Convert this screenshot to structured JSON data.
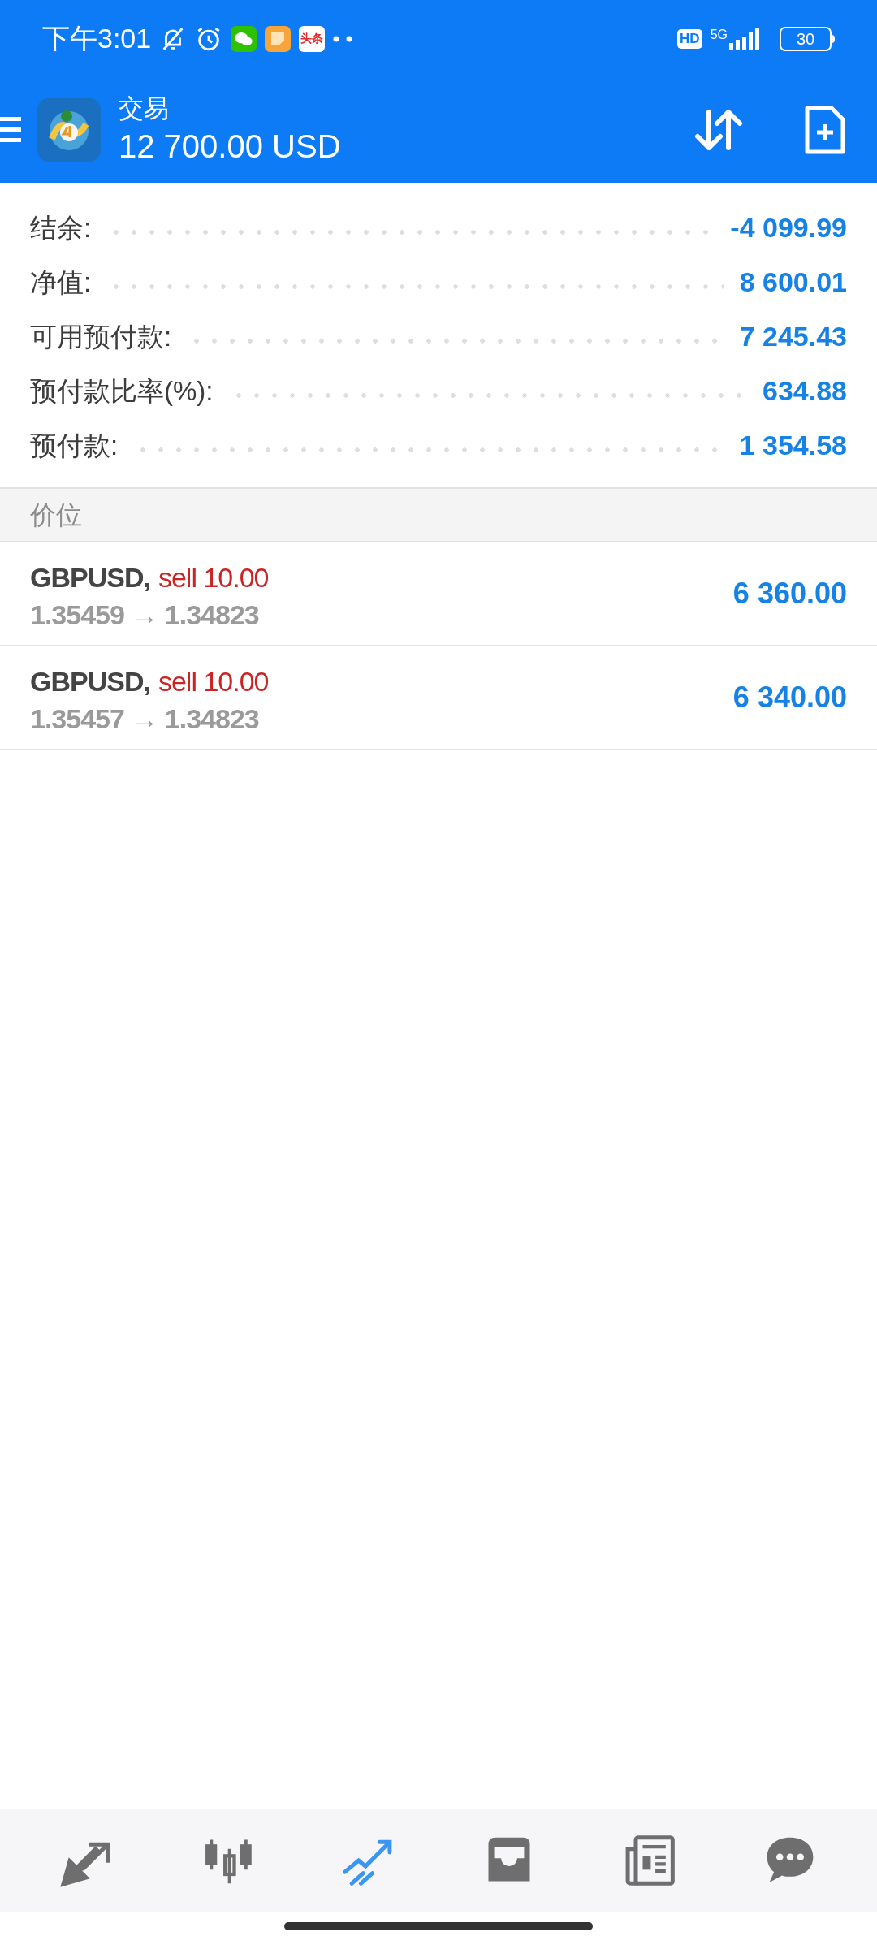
{
  "status_bar": {
    "time": "下午3:01",
    "app_badge": "头条",
    "network": "5G",
    "battery": "30",
    "hd": "HD"
  },
  "header": {
    "title": "交易",
    "balance": "12 700.00 USD"
  },
  "summary": [
    {
      "label": "结余:",
      "value": "-4 099.99"
    },
    {
      "label": "净值:",
      "value": "8 600.01"
    },
    {
      "label": "可用预付款:",
      "value": "7 245.43"
    },
    {
      "label": "预付款比率(%):",
      "value": "634.88"
    },
    {
      "label": "预付款:",
      "value": "1 354.58"
    }
  ],
  "section_title": "价位",
  "positions": [
    {
      "symbol": "GBPUSD,",
      "order": "sell 10.00",
      "prices": "1.35459 → 1.34823",
      "profit": "6 360.00"
    },
    {
      "symbol": "GBPUSD,",
      "order": "sell 10.00",
      "prices": "1.35457 → 1.34823",
      "profit": "6 340.00"
    }
  ],
  "bottom_nav": [
    {
      "kind": "quotes",
      "selected": false
    },
    {
      "kind": "chart",
      "selected": false
    },
    {
      "kind": "trade",
      "selected": true
    },
    {
      "kind": "history",
      "selected": false
    },
    {
      "kind": "news",
      "selected": false
    },
    {
      "kind": "chat",
      "selected": false
    }
  ]
}
